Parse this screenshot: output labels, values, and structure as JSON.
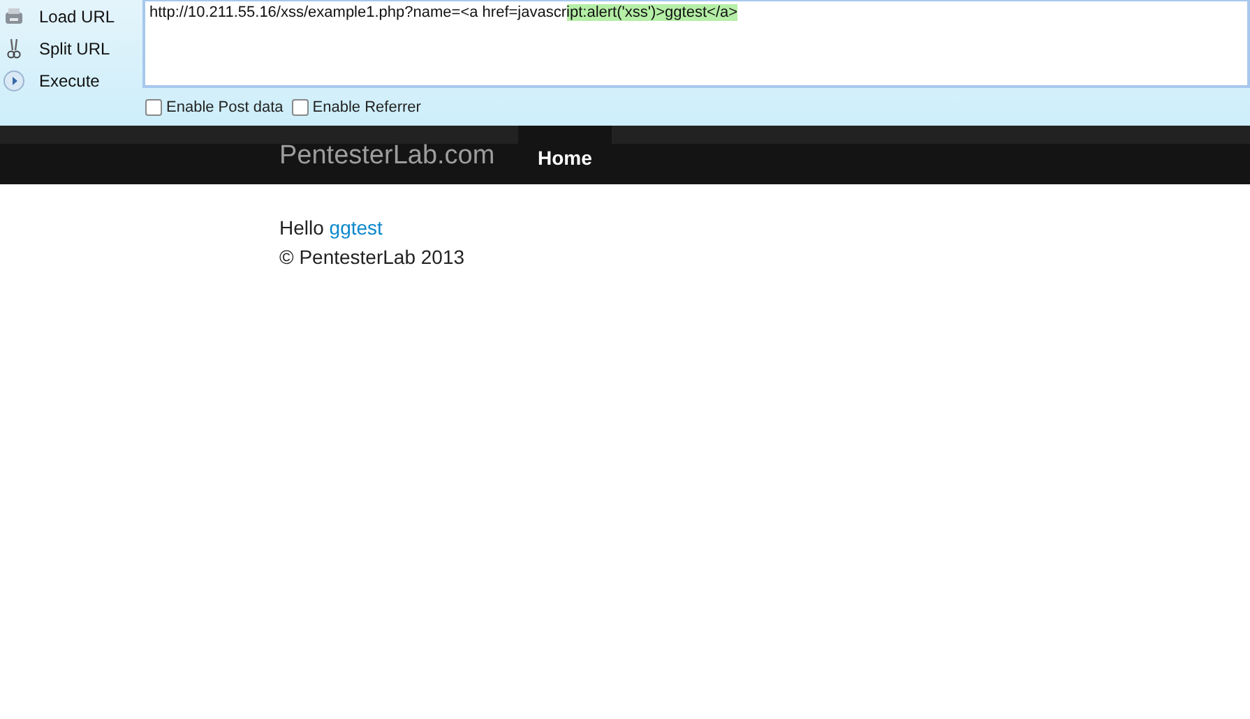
{
  "toolbar": {
    "actions": [
      {
        "label": "Load URL",
        "kind": "load"
      },
      {
        "label": "Split URL",
        "kind": "split"
      },
      {
        "label": "Execute",
        "kind": "execute"
      }
    ],
    "url": {
      "text": "http://10.211.55.16/xss/example1.php?name=<a href=javascr",
      "selected_text": "ipt:alert('xss')>ggtest</a>"
    },
    "options": [
      {
        "label": "Enable Post data",
        "checked": false
      },
      {
        "label": "Enable Referrer",
        "checked": false
      }
    ]
  },
  "navbar": {
    "brand": "PentesterLab.com",
    "items": [
      {
        "label": "Home",
        "selected": true
      }
    ]
  },
  "content": {
    "greeting": "Hello",
    "link": "ggtest",
    "footer": "© PentesterLab 2013"
  }
}
